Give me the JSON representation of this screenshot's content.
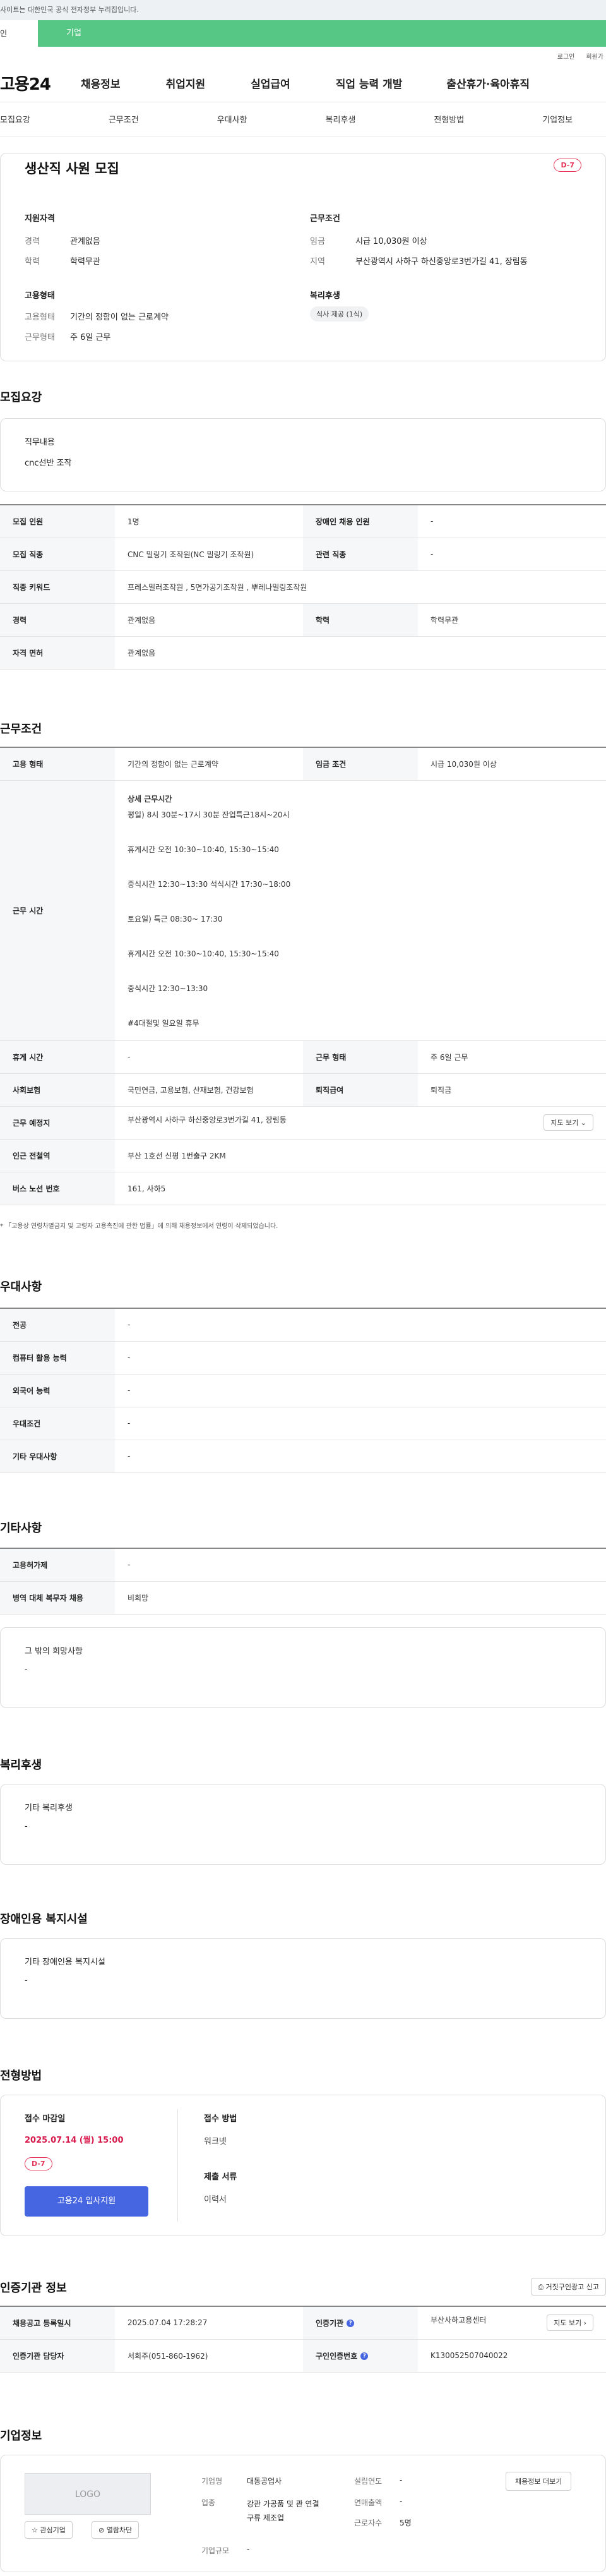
{
  "topbar": {
    "notice": "사이트는 대한민국 공식 전자정부 누리집입니다."
  },
  "tabs": {
    "personal": "인",
    "company": "기업"
  },
  "util": {
    "login": "로그인",
    "join": "회원가"
  },
  "gnb": {
    "logo": "고용24",
    "items": [
      "채용정보",
      "취업지원",
      "실업급여",
      "직업 능력 개발",
      "출산휴가·육아휴직"
    ]
  },
  "subnav": [
    "모집요강",
    "근무조건",
    "우대사항",
    "복리후생",
    "전형방법",
    "기업정보"
  ],
  "summary": {
    "title": "생산직 사원 모집",
    "dday": "D-7",
    "qual_h": "지원자격",
    "qual": [
      {
        "k": "경력",
        "v": "관계없음"
      },
      {
        "k": "학력",
        "v": "학력무관"
      }
    ],
    "cond_h": "근무조건",
    "cond": [
      {
        "k": "임금",
        "v": "시급 10,030원 이상"
      },
      {
        "k": "지역",
        "v": "부산광역시 사하구 하신중앙로3번가길 41, 장림동"
      }
    ],
    "emp_h": "고용형태",
    "emp": [
      {
        "k": "고용형태",
        "v": "기간의 정함이 없는 근로계약"
      },
      {
        "k": "근무형태",
        "v": "주 6일 근무"
      }
    ],
    "wel_h": "복리후생",
    "wel_chip": "식사 제공 (1식)"
  },
  "recruit": {
    "title": "모집요강",
    "duty_label": "직무내용",
    "duty": "cnc선반 조작",
    "rows": [
      [
        "모집 인원",
        "1명",
        "장애인 채용 인원",
        "-"
      ],
      [
        "모집 직종",
        "CNC 밀링기 조작원(NC 밀링기 조작원)",
        "관련 직종",
        "-"
      ],
      [
        "직종 키워드",
        "프레스밀러조작원 , 5면가공기조작원 , 뿌레나밀링조작원",
        "",
        ""
      ],
      [
        "경력",
        "관계없음",
        "학력",
        "학력무관"
      ],
      [
        "자격 면허",
        "관계없음",
        "",
        ""
      ]
    ]
  },
  "work": {
    "title": "근무조건",
    "r1": [
      "고용 형태",
      "기간의 정함이 없는 근로계약",
      "임금 조건",
      "시급 10,030원 이상"
    ],
    "hours_h": "근무 시간",
    "hours_sub": "상세 근무시간",
    "hours": [
      "평일) 8시 30분~17시 30분 잔업특근18시~20시",
      "휴게시간 오전 10:30~10:40, 15:30~15:40",
      "중식시간 12:30~13:30 석식시간 17:30~18:00",
      "토요일) 특근 08:30~ 17:30",
      "휴게시간 오전 10:30~10:40, 15:30~15:40",
      "중식시간 12:30~13:30",
      "#4대절및 일요일 휴무"
    ],
    "r2": [
      "휴게 시간",
      "-",
      "근무 형태",
      "주 6일 근무"
    ],
    "r3": [
      "사회보험",
      "국민연금, 고용보험, 산재보험, 건강보험",
      "퇴직급여",
      "퇴직금"
    ],
    "r4": [
      "근무 예정지",
      "부산광역시 사하구 하신중앙로3번가길 41, 장림동"
    ],
    "map_btn": "지도 보기",
    "r5": [
      "인근 전철역",
      "부산 1호선 신평 1번출구 2KM"
    ],
    "r6": [
      "버스 노선 번호",
      "161, 사하5"
    ],
    "note": "* 「고용상 연령차별금지 및 고령자 고용촉진에 관한 법률」에 의해 채용정보에서 연령이 삭제되었습니다."
  },
  "pref": {
    "title": "우대사항",
    "rows": [
      [
        "전공",
        "-"
      ],
      [
        "컴퓨터 활용 능력",
        "-"
      ],
      [
        "외국어 능력",
        "-"
      ],
      [
        "우대조건",
        "-"
      ],
      [
        "기타 우대사항",
        "-"
      ]
    ]
  },
  "etc": {
    "title": "기타사항",
    "rows": [
      [
        "고용허가제",
        "-"
      ],
      [
        "병역 대체 복무자 채용",
        "비희망"
      ]
    ],
    "wish_label": "그 밖의 희망사항",
    "wish": "-"
  },
  "welfare": {
    "title": "복리후생",
    "label": "기타 복리후생",
    "value": "-"
  },
  "disab": {
    "title": "장애인용 복지시설",
    "label": "기타 장애인용 복지시설",
    "value": "-"
  },
  "apply": {
    "title": "전형방법",
    "deadline_h": "접수 마감일",
    "deadline": "2025.07.14 (월) 15:00",
    "dday": "D-7",
    "btn": "고용24 입사지원",
    "method_h": "접수 방법",
    "method": "워크넷",
    "docs_h": "제출 서류",
    "docs": "이력서"
  },
  "cert": {
    "title": "인증기관 정보",
    "report_btn": "거짓구인광고 신고",
    "r1": [
      "채용공고 등록일시",
      "2025.07.04 17:28:27",
      "인증기관",
      "부산사하고용센터"
    ],
    "r2": [
      "인증기관 담당자",
      "서희주(051-860-1962)",
      "구인인증번호",
      "K130052507040022"
    ],
    "map_btn": "지도 보기"
  },
  "company": {
    "title": "기업정보",
    "logo": "LOGO",
    "fav_btn": "관심기업",
    "block_btn": "열람차단",
    "more_btn": "채용정보 더보기",
    "name_k": "기업명",
    "name": "대동공업사",
    "ind_k": "업종",
    "ind": "강관 가공품 및 관 연결구류 제조업",
    "size_k": "기업규모",
    "size": "-",
    "est_k": "설립연도",
    "est": "-",
    "rev_k": "연매출액",
    "rev": "-",
    "emp_k": "근로자수",
    "emp": "5명"
  }
}
